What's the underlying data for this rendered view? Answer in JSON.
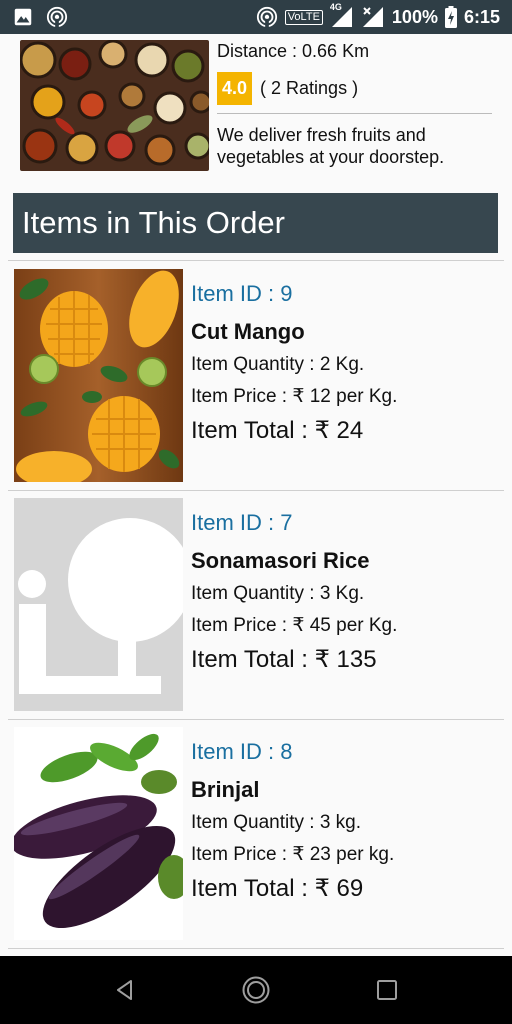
{
  "status_bar": {
    "battery": "100%",
    "time": "6:15",
    "volte": "VoLTE",
    "network": "4G"
  },
  "store": {
    "distance": "Distance : 0.66 Km",
    "rating": "4.0",
    "ratings_count": "( 2 Ratings )",
    "description": "We deliver fresh fruits and vegetables at your doorstep."
  },
  "section": {
    "title": "Items in This Order"
  },
  "items": [
    {
      "id": "Item ID : 9",
      "name": "Cut Mango",
      "quantity": "Item Quantity : 2 Kg.",
      "price": "Item Price : ₹ 12 per Kg.",
      "total": "Item Total : ₹ 24"
    },
    {
      "id": "Item ID : 7",
      "name": "Sonamasori Rice",
      "quantity": "Item Quantity : 3 Kg.",
      "price": "Item Price : ₹ 45 per Kg.",
      "total": "Item Total : ₹ 135"
    },
    {
      "id": "Item ID : 8",
      "name": "Brinjal",
      "quantity": "Item Quantity : 3 kg.",
      "price": "Item Price : ₹ 23 per kg.",
      "total": "Item Total : ₹ 69"
    }
  ],
  "colors": {
    "status_bar": "#2f3e46",
    "section_header": "#37474f",
    "item_id": "#1a6fa0",
    "rating_badge": "#f4b400"
  }
}
